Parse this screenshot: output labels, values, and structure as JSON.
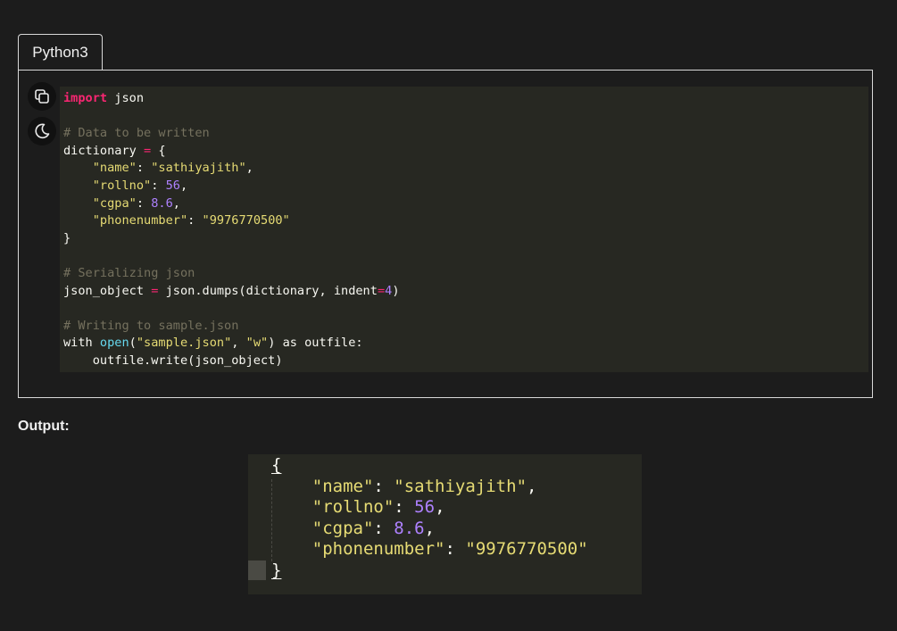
{
  "tab": {
    "label": "Python3"
  },
  "buttons": {
    "copy_icon": "copy-icon",
    "theme_icon": "moon-icon"
  },
  "code": {
    "l1": {
      "kw": "import",
      "rest": " json"
    },
    "l3": {
      "cm": "# Data to be written"
    },
    "l4": {
      "name": "dictionary ",
      "op": "=",
      "rest": " {"
    },
    "l5": {
      "indent": "    ",
      "key": "\"name\"",
      "sep": ": ",
      "val": "\"sathiyajith\"",
      "tail": ","
    },
    "l6": {
      "indent": "    ",
      "key": "\"rollno\"",
      "sep": ": ",
      "val": "56",
      "tail": ","
    },
    "l7": {
      "indent": "    ",
      "key": "\"cgpa\"",
      "sep": ": ",
      "val": "8.6",
      "tail": ","
    },
    "l8": {
      "indent": "    ",
      "key": "\"phonenumber\"",
      "sep": ": ",
      "val": "\"9976770500\"",
      "tail": ""
    },
    "l9": {
      "text": "}"
    },
    "l11": {
      "cm": "# Serializing json"
    },
    "l12": {
      "a": "json_object ",
      "op": "=",
      "b": " json.dumps(dictionary, indent",
      "op2": "=",
      "num": "4",
      "c": ")"
    },
    "l14": {
      "cm": "# Writing to sample.json"
    },
    "l15": {
      "a": "with ",
      "fn": "open",
      "b": "(",
      "s1": "\"sample.json\"",
      "c": ", ",
      "s2": "\"w\"",
      "d": ") as outfile:"
    },
    "l16": {
      "text": "    outfile.write(json_object)"
    }
  },
  "output": {
    "label": "Output:",
    "open_brace": "{",
    "close_brace": "}",
    "lines": [
      {
        "indent": "    ",
        "key": "\"name\"",
        "sep": ": ",
        "val": "\"sathiyajith\"",
        "tail": ","
      },
      {
        "indent": "    ",
        "key": "\"rollno\"",
        "sep": ": ",
        "val": "56",
        "tail": ","
      },
      {
        "indent": "    ",
        "key": "\"cgpa\"",
        "sep": ": ",
        "val": "8.6",
        "tail": ","
      },
      {
        "indent": "    ",
        "key": "\"phonenumber\"",
        "sep": ": ",
        "val": "\"9976770500\"",
        "tail": ""
      }
    ]
  },
  "colors": {
    "keyword": "#f92672",
    "string": "#e6db74",
    "number": "#ae81ff",
    "comment": "#75715e",
    "function": "#66d9ef",
    "code_bg": "#272822",
    "page_bg": "#1c1c1c"
  }
}
